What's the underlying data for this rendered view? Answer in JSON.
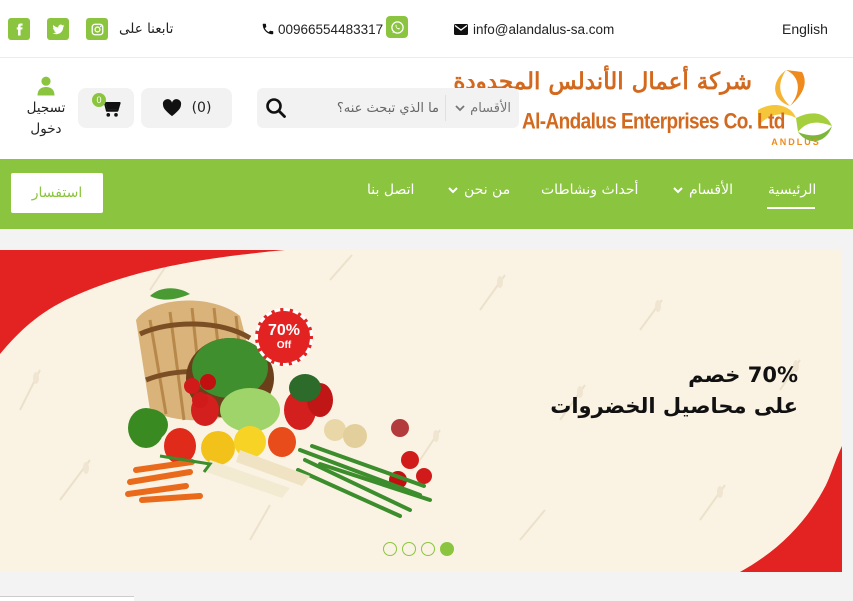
{
  "topbar": {
    "language": "English",
    "email": "info@alandalus-sa.com",
    "phone": "00966554483317",
    "follow_us": "تابعنا على"
  },
  "header": {
    "logo_arabic": "شركة أعمال الأندلس المحدودة",
    "logo_english": "Al-Andalus Enterprises Co. Ltd",
    "logo_mark_text": "ANDLUS",
    "categories_select": "الأقسام",
    "search_placeholder": "ما الذي تبحث عنه؟",
    "wishlist_count": "(0)",
    "cart_badge": "0",
    "login_line1": "تسجيل",
    "login_line2": "دخول"
  },
  "nav": {
    "items": [
      {
        "label": "الرئيسية",
        "active": true
      },
      {
        "label": "الأقسام",
        "dropdown": true
      },
      {
        "label": "أحداث ونشاطات"
      },
      {
        "label": "من نحن",
        "dropdown": true
      },
      {
        "label": "اتصل بنا"
      }
    ],
    "inquiry_button": "استفسار"
  },
  "hero": {
    "headline_line1": "70% خصم",
    "headline_line2": "على محاصيل الخضروات",
    "badge_percent": "70%",
    "badge_off": "Off",
    "slides": 4,
    "active_slide": 1
  },
  "colors": {
    "accent_green": "#8bc53f",
    "hero_bg": "#faf3e4",
    "hero_red": "#e32222"
  }
}
